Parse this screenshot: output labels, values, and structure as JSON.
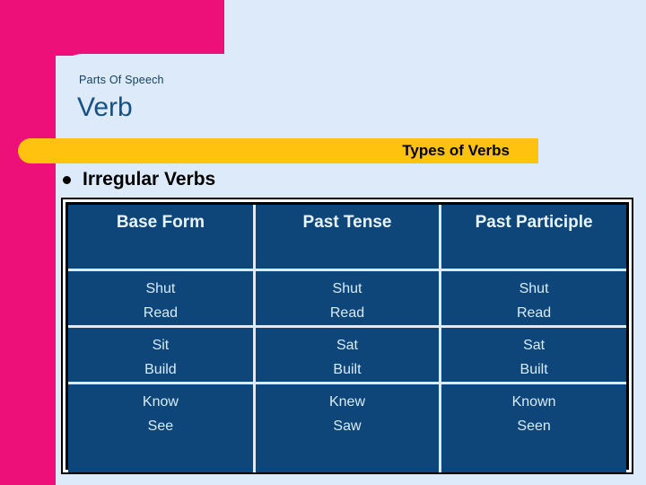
{
  "slide": {
    "kicker": "Parts Of Speech",
    "title": "Verb",
    "banner_text": "Types of Verbs",
    "bullet": {
      "icon": "bullet-dot-icon",
      "label": "Irregular Verbs"
    }
  },
  "colors": {
    "background": "#dceafa",
    "accent_pink": "#ec1078",
    "accent_yellow": "#ffc20e",
    "table_navy": "#0f4679",
    "title_blue": "#155182",
    "cell_text": "#d6ecf7",
    "frame_black": "#000000"
  },
  "table": {
    "headers": [
      "Base Form",
      "Past Tense",
      "Past Participle"
    ],
    "rows": [
      {
        "base": [
          "Shut",
          "Read"
        ],
        "past": [
          "Shut",
          "Read"
        ],
        "participle": [
          "Shut",
          "Read"
        ]
      },
      {
        "base": [
          "Sit",
          "Build"
        ],
        "past": [
          "Sat",
          "Built"
        ],
        "participle": [
          "Sat",
          "Built"
        ]
      },
      {
        "base": [
          "Know",
          "See"
        ],
        "past": [
          "Knew",
          "Saw"
        ],
        "participle": [
          "Known",
          "Seen"
        ]
      }
    ]
  }
}
